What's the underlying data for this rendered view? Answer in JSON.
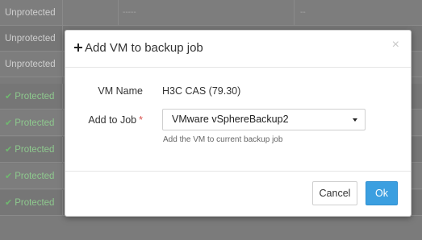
{
  "background_table": {
    "rows": [
      {
        "status": "Unprotected",
        "protected": false,
        "col2": "-----",
        "col3": "--"
      },
      {
        "status": "Unprotected",
        "protected": false,
        "col2": "",
        "col3": ""
      },
      {
        "status": "Unprotected",
        "protected": false,
        "col2": "",
        "col3": ""
      },
      {
        "status": "Protected",
        "protected": true,
        "col2": "",
        "col3": ""
      },
      {
        "status": "Protected",
        "protected": true,
        "col2": "",
        "col3": ""
      },
      {
        "status": "Protected",
        "protected": true,
        "col2": "",
        "col3": ""
      },
      {
        "status": "Protected",
        "protected": true,
        "col2": "",
        "col3": ""
      },
      {
        "status": "Protected",
        "protected": true,
        "col2": "",
        "col3": ""
      }
    ]
  },
  "modal": {
    "title": "Add VM to backup job",
    "close_symbol": "×",
    "vm_name_label": "VM Name",
    "vm_name_value": "H3C CAS  (79.30)",
    "add_to_job_label": "Add to Job",
    "required_mark": "*",
    "job_selected": "VMware vSphereBackup2",
    "help_text": "Add the VM to current backup job",
    "cancel_label": "Cancel",
    "ok_label": "Ok"
  },
  "colors": {
    "primary": "#3b9fe0",
    "required": "#d9534f",
    "protected_green": "#6fb86f"
  }
}
